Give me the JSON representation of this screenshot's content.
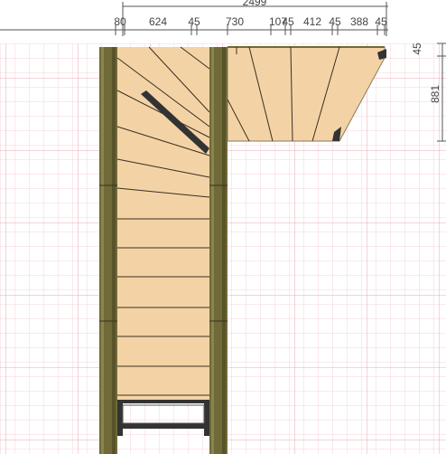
{
  "colors": {
    "background": "#ffffff",
    "grid_minor": "#f3c9cf",
    "grid_major": "#e89aa3",
    "dim_line": "#555555",
    "dim_text": "#444444",
    "wood_light": "#f3d3a6",
    "wood_dark": "#6f6a37",
    "tread_line": "#3a3020",
    "metal": "#333333"
  },
  "dimensions": {
    "overall_width": "2499",
    "top_segments": [
      "80",
      "624",
      "45",
      "730",
      "107",
      "45",
      "412",
      "45",
      "388",
      "45"
    ],
    "right_top": "45",
    "right_height": "881"
  },
  "icons": {
    "stair_plan": "stair-plan-drawing",
    "handrail": "handrail-bar",
    "bottom_step_frame": "metal-step-frame"
  }
}
